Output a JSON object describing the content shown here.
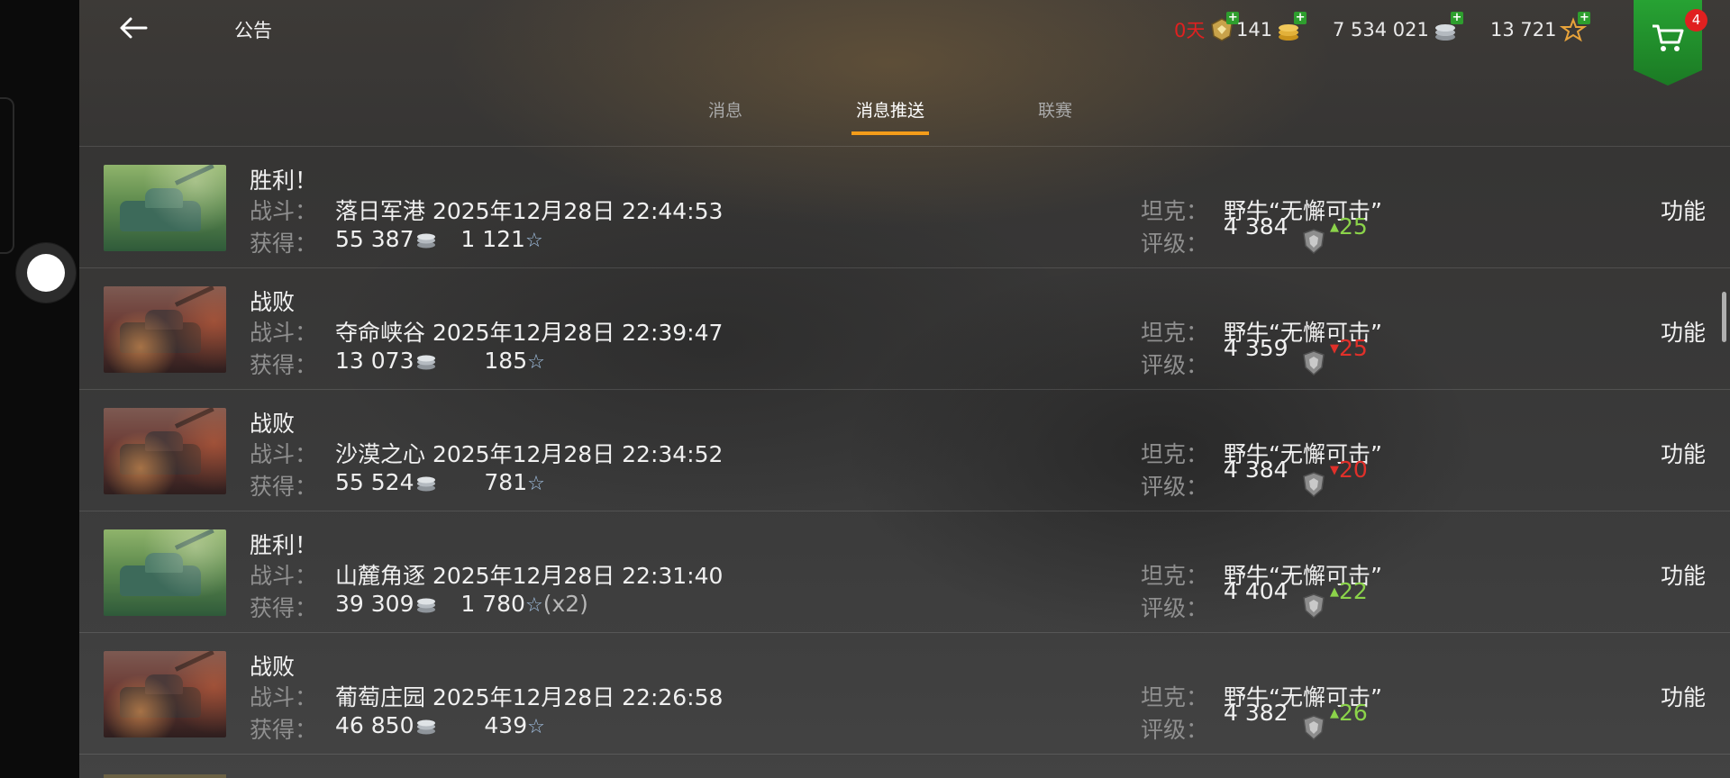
{
  "header": {
    "title": "公告",
    "premium_days": "0天",
    "gold": "141",
    "silver": "7 534 021",
    "free_xp": "13 721",
    "cart_badge": "4"
  },
  "tabs": [
    {
      "label": "消息",
      "active": false
    },
    {
      "label": "消息推送",
      "active": true
    },
    {
      "label": "联赛",
      "active": false
    }
  ],
  "labels": {
    "battle": "战斗：",
    "earned": "获得：",
    "tank": "坦克：",
    "rating": "评级：",
    "function": "功能"
  },
  "colors": {
    "accent": "#f39c1a",
    "rating_up": "#8bd34a",
    "rating_down": "#e0302a",
    "premium_red": "#e02020"
  },
  "messages": [
    {
      "result": "胜利！",
      "outcome": "win",
      "map_time": "落日军港 2025年12月28日 22:44:53",
      "silver": "55 387",
      "xp": "1 121",
      "xp_suffix": "",
      "tank": "野牛“无懈可击”",
      "rating": "4 384",
      "delta": "25",
      "delta_dir": "up"
    },
    {
      "result": "战败",
      "outcome": "loss",
      "map_time": "夺命峡谷 2025年12月28日 22:39:47",
      "silver": "13 073",
      "xp": "185",
      "xp_suffix": "",
      "tank": "野牛“无懈可击”",
      "rating": "4 359",
      "delta": "25",
      "delta_dir": "down"
    },
    {
      "result": "战败",
      "outcome": "loss",
      "map_time": "沙漠之心 2025年12月28日 22:34:52",
      "silver": "55 524",
      "xp": "781",
      "xp_suffix": "",
      "tank": "野牛“无懈可击”",
      "rating": "4 384",
      "delta": "20",
      "delta_dir": "down"
    },
    {
      "result": "胜利！",
      "outcome": "win",
      "map_time": "山麓角逐 2025年12月28日 22:31:40",
      "silver": "39 309",
      "xp": "1 780",
      "xp_suffix": "(x2)",
      "tank": "野牛“无懈可击”",
      "rating": "4 404",
      "delta": "22",
      "delta_dir": "up"
    },
    {
      "result": "战败",
      "outcome": "loss",
      "map_time": "葡萄庄园 2025年12月28日 22:26:58",
      "silver": "46 850",
      "xp": "439",
      "xp_suffix": "",
      "tank": "野牛“无懈可击”",
      "rating": "4 382",
      "delta": "26",
      "delta_dir": "up"
    }
  ]
}
